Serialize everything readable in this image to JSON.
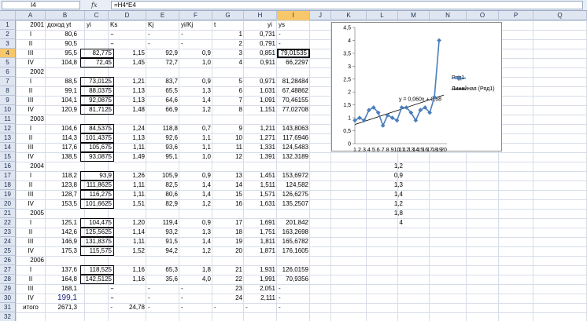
{
  "formula_bar": {
    "cell_ref": "I4",
    "fx_label": "fx",
    "formula": "=H4*E4"
  },
  "columns": [
    "A",
    "B",
    "C",
    "D",
    "E",
    "F",
    "G",
    "H",
    "I",
    "J",
    "K",
    "L",
    "M",
    "N",
    "O",
    "P",
    "Q"
  ],
  "active_column": "I",
  "rows": [
    "1",
    "2",
    "3",
    "4",
    "5",
    "6",
    "7",
    "8",
    "9",
    "10",
    "11",
    "12",
    "13",
    "14",
    "15",
    "16",
    "17",
    "18",
    "19",
    "20",
    "21",
    "22",
    "23",
    "24",
    "25",
    "26",
    "27",
    "28",
    "29",
    "30",
    "31",
    "32"
  ],
  "active_row": "4",
  "headers": {
    "a1": "2001",
    "b1": "доход yt",
    "c1": "yi",
    "d1": "Ks",
    "e1": "Kj",
    "f1": "yi/Kj",
    "g1": "t",
    "h1": "yi",
    "i1": "ys"
  },
  "table_rows": [
    {
      "row": 2,
      "a": "I",
      "b": "80,6",
      "c": "-",
      "d": "-",
      "e": "-",
      "f": "-",
      "g": "1",
      "h": "0,731",
      "i": "-"
    },
    {
      "row": 3,
      "a": "II",
      "b": "90,5",
      "c": "-",
      "d": "-",
      "e": "-",
      "f": "-",
      "g": "2",
      "h": "0,791",
      "i": "-"
    },
    {
      "row": 4,
      "a": "III",
      "b": "95,5",
      "c": "82,775",
      "d": "1,15",
      "e": "92,9",
      "f": "0,9",
      "g": "3",
      "h": "0,851",
      "i": "79,01535"
    },
    {
      "row": 5,
      "a": "IV",
      "b": "104,8",
      "c": "72,45",
      "d": "1,45",
      "e": "72,7",
      "f": "1,0",
      "g": "4",
      "h": "0,911",
      "i": "66,2297"
    },
    {
      "row": 6,
      "a": "2002",
      "b": "",
      "c": "",
      "d": "",
      "e": "",
      "f": "",
      "g": "",
      "h": "",
      "i": ""
    },
    {
      "row": 7,
      "a": "I",
      "b": "88,5",
      "c": "73,0125",
      "d": "1,21",
      "e": "83,7",
      "f": "0,9",
      "g": "5",
      "h": "0,971",
      "i": "81,28484"
    },
    {
      "row": 8,
      "a": "II",
      "b": "99,1",
      "c": "88,0375",
      "d": "1,13",
      "e": "65,5",
      "f": "1,3",
      "g": "6",
      "h": "1,031",
      "i": "67,48862"
    },
    {
      "row": 9,
      "a": "III",
      "b": "104,1",
      "c": "92,0875",
      "d": "1,13",
      "e": "64,6",
      "f": "1,4",
      "g": "7",
      "h": "1,091",
      "i": "70,46155"
    },
    {
      "row": 10,
      "a": "IV",
      "b": "120,9",
      "c": "81,7125",
      "d": "1,48",
      "e": "66,9",
      "f": "1,2",
      "g": "8",
      "h": "1,151",
      "i": "77,02708"
    },
    {
      "row": 11,
      "a": "2003",
      "b": "",
      "c": "",
      "d": "",
      "e": "",
      "f": "",
      "g": "",
      "h": "",
      "i": ""
    },
    {
      "row": 12,
      "a": "I",
      "b": "104,6",
      "c": "84,5375",
      "d": "1,24",
      "e": "118,8",
      "f": "0,7",
      "g": "9",
      "h": "1,211",
      "i": "143,8063"
    },
    {
      "row": 13,
      "a": "II",
      "b": "114,3",
      "c": "101,4375",
      "d": "1,13",
      "e": "92,6",
      "f": "1,1",
      "g": "10",
      "h": "1,271",
      "i": "117,6946"
    },
    {
      "row": 14,
      "a": "III",
      "b": "117,6",
      "c": "105,675",
      "d": "1,11",
      "e": "93,6",
      "f": "1,1",
      "g": "11",
      "h": "1,331",
      "i": "124,5483"
    },
    {
      "row": 15,
      "a": "IV",
      "b": "138,5",
      "c": "93,0875",
      "d": "1,49",
      "e": "95,1",
      "f": "1,0",
      "g": "12",
      "h": "1,391",
      "i": "132,3189"
    },
    {
      "row": 16,
      "a": "2004",
      "b": "",
      "c": "",
      "d": "",
      "e": "",
      "f": "",
      "g": "",
      "h": "",
      "i": ""
    },
    {
      "row": 17,
      "a": "I",
      "b": "118,2",
      "c": "93,9",
      "d": "1,26",
      "e": "105,9",
      "f": "0,9",
      "g": "13",
      "h": "1,451",
      "i": "153,6972"
    },
    {
      "row": 18,
      "a": "II",
      "b": "123,8",
      "c": "111,8625",
      "d": "1,11",
      "e": "82,5",
      "f": "1,4",
      "g": "14",
      "h": "1,511",
      "i": "124,582"
    },
    {
      "row": 19,
      "a": "III",
      "b": "128,7",
      "c": "116,275",
      "d": "1,11",
      "e": "80,6",
      "f": "1,4",
      "g": "15",
      "h": "1,571",
      "i": "126,6275"
    },
    {
      "row": 20,
      "a": "IV",
      "b": "153,5",
      "c": "101,6625",
      "d": "1,51",
      "e": "82,9",
      "f": "1,2",
      "g": "16",
      "h": "1,631",
      "i": "135,2507"
    },
    {
      "row": 21,
      "a": "2005",
      "b": "",
      "c": "",
      "d": "",
      "e": "",
      "f": "",
      "g": "",
      "h": "",
      "i": ""
    },
    {
      "row": 22,
      "a": "I",
      "b": "125,1",
      "c": "104,475",
      "d": "1,20",
      "e": "119,4",
      "f": "0,9",
      "g": "17",
      "h": "1,691",
      "i": "201,842"
    },
    {
      "row": 23,
      "a": "II",
      "b": "142,6",
      "c": "125,5625",
      "d": "1,14",
      "e": "93,2",
      "f": "1,3",
      "g": "18",
      "h": "1,751",
      "i": "163,2698"
    },
    {
      "row": 24,
      "a": "III",
      "b": "146,9",
      "c": "131,8375",
      "d": "1,11",
      "e": "91,5",
      "f": "1,4",
      "g": "19",
      "h": "1,811",
      "i": "165,6782"
    },
    {
      "row": 25,
      "a": "IV",
      "b": "175,3",
      "c": "115,575",
      "d": "1,52",
      "e": "94,2",
      "f": "1,2",
      "g": "20",
      "h": "1,871",
      "i": "176,1605"
    },
    {
      "row": 26,
      "a": "2006",
      "b": "",
      "c": "",
      "d": "",
      "e": "",
      "f": "",
      "g": "",
      "h": "",
      "i": ""
    },
    {
      "row": 27,
      "a": "I",
      "b": "137,6",
      "c": "118,525",
      "d": "1,16",
      "e": "65,3",
      "f": "1,8",
      "g": "21",
      "h": "1,931",
      "i": "126,0159"
    },
    {
      "row": 28,
      "a": "II",
      "b": "164,8",
      "c": "142,5125",
      "d": "1,16",
      "e": "35,6",
      "f": "4,0",
      "g": "22",
      "h": "1,991",
      "i": "70,9356"
    },
    {
      "row": 29,
      "a": "III",
      "b": "168,1",
      "c": "-",
      "d": "-",
      "e": "-",
      "f": "-",
      "g": "23",
      "h": "2,051",
      "i": "-"
    },
    {
      "row": 30,
      "a": "IV",
      "b": "199,1",
      "c": "-",
      "d": "-",
      "e": "-",
      "f": "-",
      "g": "24",
      "h": "2,111",
      "i": "-"
    },
    {
      "row": 31,
      "a": "итого",
      "b": "2671,3",
      "c": "-",
      "d": "24,78",
      "e": "-",
      "f": "-",
      "g": "-",
      "h": "-",
      "i": "-"
    }
  ],
  "k_column": [
    "1,2",
    "0,9",
    "1,3",
    "1,4",
    "1,2",
    "1,8",
    "4"
  ],
  "chart_data": {
    "type": "line",
    "x": [
      1,
      2,
      3,
      4,
      5,
      6,
      7,
      8,
      9,
      10,
      11,
      12,
      13,
      14,
      15,
      16,
      17,
      18,
      19,
      20
    ],
    "series": [
      {
        "name": "Ряд1",
        "values": [
          0.9,
          1.0,
          0.9,
          1.3,
          1.4,
          1.2,
          0.7,
          1.1,
          1.0,
          0.9,
          1.4,
          1.4,
          1.2,
          0.9,
          1.3,
          1.4,
          1.2,
          1.8,
          4.0
        ]
      },
      {
        "name": "Линейная (Ряд1)",
        "trend": {
          "slope": 0.06,
          "intercept": 0.68
        }
      }
    ],
    "trendline_label": "y = 0,060x + 0,68",
    "ylim": [
      0,
      4.5
    ],
    "y_ticks": [
      "0",
      "0,5",
      "1",
      "1,5",
      "2",
      "2,5",
      "3",
      "3,5",
      "4",
      "4,5"
    ],
    "x_ticks": [
      "1",
      "2",
      "3",
      "4",
      "5",
      "6",
      "7",
      "8",
      "9",
      "10",
      "11",
      "12",
      "13",
      "14",
      "15",
      "16",
      "17",
      "18",
      "19",
      "20"
    ],
    "legend_position": "right",
    "series_color": "#4a7ebb",
    "trend_color": "#000000"
  }
}
